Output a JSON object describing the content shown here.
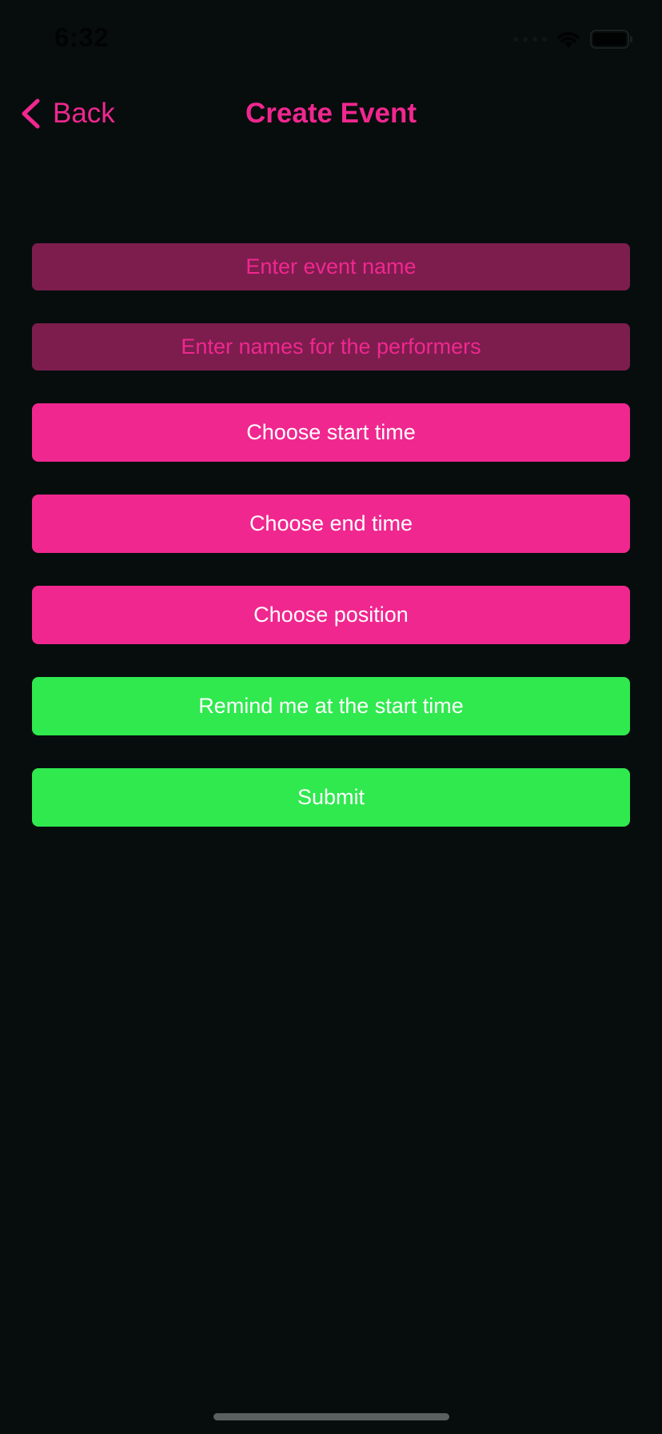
{
  "status_bar": {
    "time": "6:32",
    "icons": [
      "signal-icon",
      "wifi-icon",
      "battery-icon"
    ]
  },
  "nav": {
    "back_label": "Back",
    "title": "Create Event"
  },
  "form": {
    "event_name_placeholder": "Enter event name",
    "performers_placeholder": "Enter names for the performers",
    "start_time_label": "Choose start time",
    "end_time_label": "Choose end time",
    "position_label": "Choose position",
    "remind_label": "Remind me at the start time",
    "submit_label": "Submit"
  },
  "colors": {
    "background": "#070d0d",
    "accent_pink": "#f0278f",
    "field_background": "#7c1d4e",
    "accent_green": "#2fe94e",
    "button_text": "#ffffff"
  }
}
